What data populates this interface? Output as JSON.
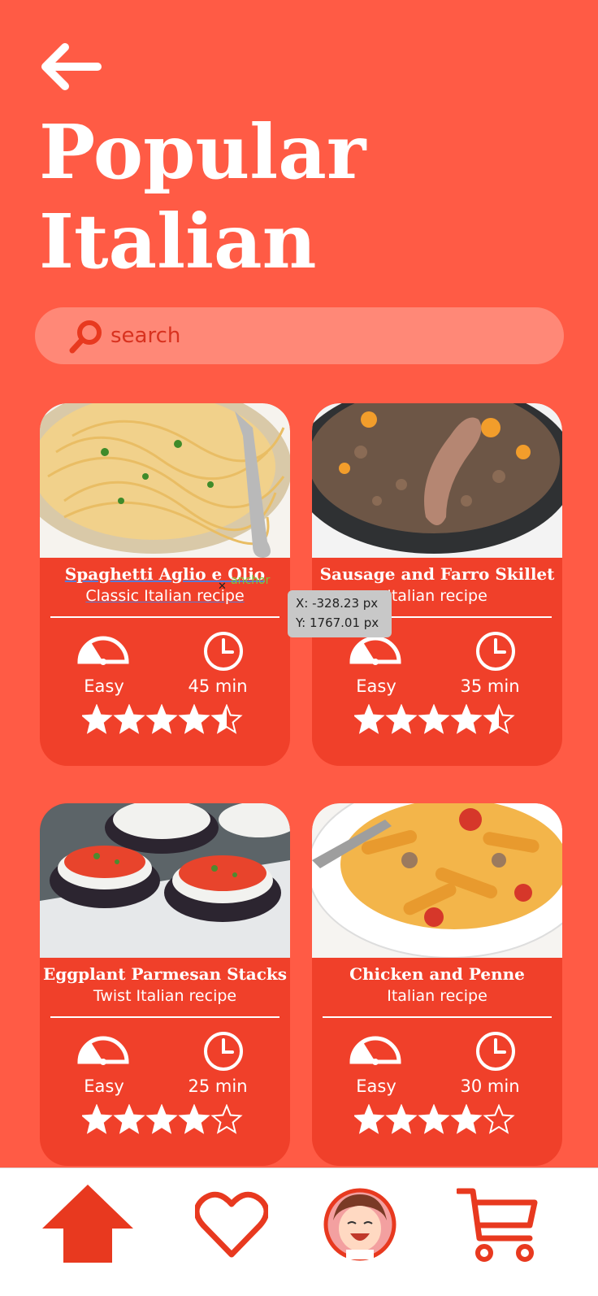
{
  "header": {
    "title_line1": "Popular",
    "title_line2": "Italian"
  },
  "search": {
    "placeholder": "search"
  },
  "recipes": [
    {
      "title": "Spaghetti Aglio e Olio",
      "subtitle": "Classic Italian recipe",
      "difficulty": "Easy",
      "time": "45 min",
      "rating": 4.5
    },
    {
      "title": "Sausage and Farro Skillet",
      "subtitle": "Italian recipe",
      "difficulty": "Easy",
      "time": "35 min",
      "rating": 4.5
    },
    {
      "title": "Eggplant Parmesan Stacks",
      "subtitle": "Twist Italian recipe",
      "difficulty": "Easy",
      "time": "25 min",
      "rating": 4
    },
    {
      "title": "Chicken and Penne",
      "subtitle": "Italian recipe",
      "difficulty": "Easy",
      "time": "30 min",
      "rating": 4
    }
  ],
  "overlay": {
    "x_readout": "X: -328.23 px",
    "y_readout": "Y: 1767.01 px",
    "anchor_label": "anchor"
  },
  "nav": {
    "items": [
      {
        "name": "home",
        "icon": "home-icon"
      },
      {
        "name": "favorites",
        "icon": "heart-icon"
      },
      {
        "name": "profile",
        "icon": "avatar"
      },
      {
        "name": "cart",
        "icon": "cart-icon"
      }
    ]
  },
  "colors": {
    "background": "#ff5b45",
    "card": "#f0402a",
    "search": "#ff8877",
    "accent": "#e8391f"
  }
}
